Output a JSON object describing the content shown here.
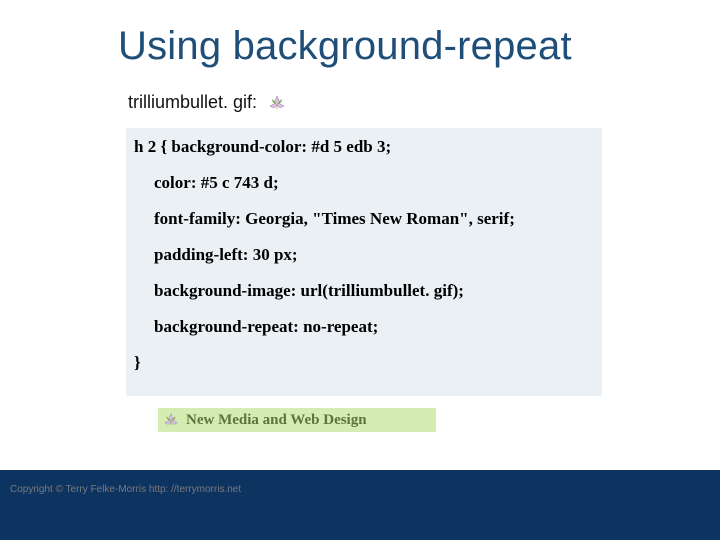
{
  "title": "Using background-repeat",
  "filename_label": "trilliumbullet. gif:",
  "code": {
    "l1": "h 2 { background-color: #d 5 edb 3;",
    "l2": "color: #5 c 743 d;",
    "l3": "font-family: Georgia, \"Times New Roman\", serif;",
    "l4": "padding-left: 30 px;",
    "l5": "background-image: url(trilliumbullet. gif);",
    "l6": "background-repeat: no-repeat;",
    "l7": "}"
  },
  "example_heading": "New Media and Web Design",
  "footer": "Copyright © Terry Felke-Morris http: //terrymorris.net",
  "colors": {
    "title": "#1f4e79",
    "code_bg": "#ebf0f5",
    "example_bg": "#d5edb3",
    "example_text": "#5c743d",
    "footer_bg": "#0d3360"
  }
}
